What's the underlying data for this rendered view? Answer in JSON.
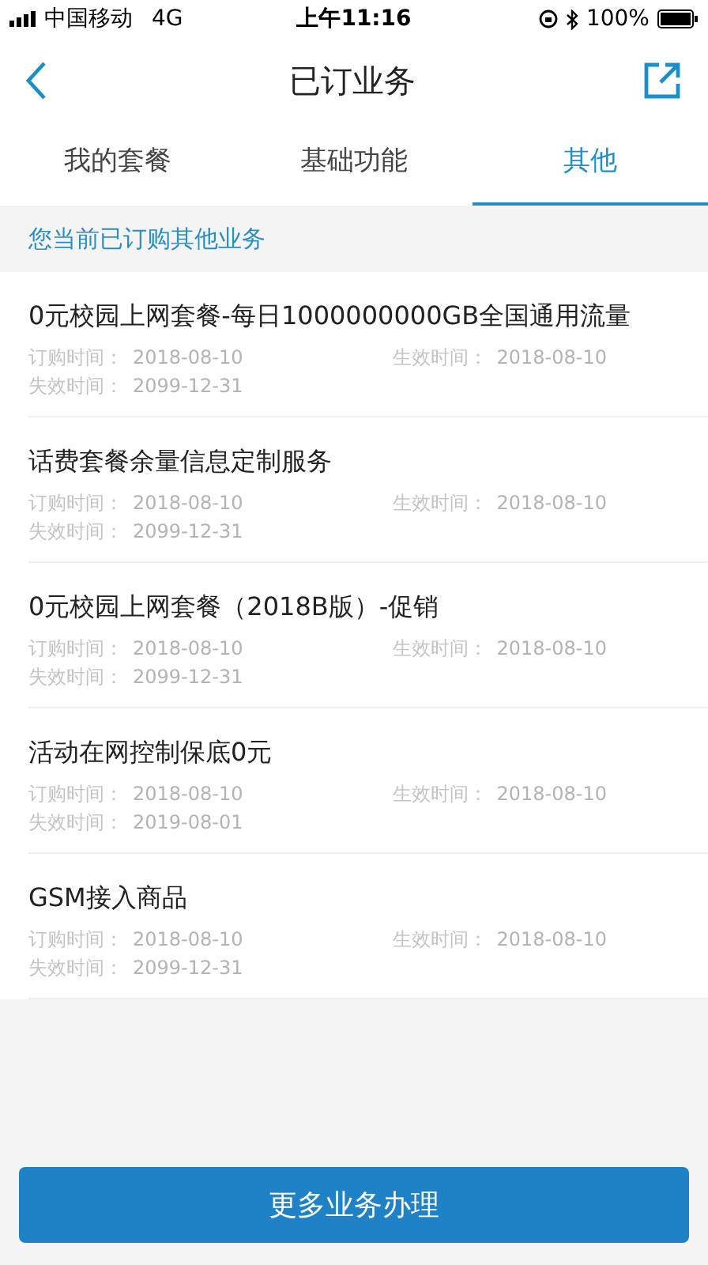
{
  "status_bar": {
    "carrier": "中国移动",
    "network": "4G",
    "time": "上午11:16",
    "battery": "100%"
  },
  "nav": {
    "title": "已订业务"
  },
  "tabs": [
    {
      "label": "我的套餐",
      "selected": false
    },
    {
      "label": "基础功能",
      "selected": false
    },
    {
      "label": "其他",
      "selected": true
    }
  ],
  "section_header": "您当前已订购其他业务",
  "services": [
    {
      "name": "0元校园上网套餐-每日1000000000GB全国通用流量",
      "ordered": {
        "label": "订购时间：",
        "value": "2018-08-10"
      },
      "effective": {
        "label": "生效时间：",
        "value": "2018-08-10"
      },
      "expires": {
        "label": "失效时间：",
        "value": "2099-12-31"
      }
    },
    {
      "name": "话费套餐余量信息定制服务",
      "ordered": {
        "label": "订购时间：",
        "value": "2018-08-10"
      },
      "effective": {
        "label": "生效时间：",
        "value": "2018-08-10"
      },
      "expires": {
        "label": "失效时间：",
        "value": "2099-12-31"
      }
    },
    {
      "name": "0元校园上网套餐（2018B版）-促销",
      "ordered": {
        "label": "订购时间：",
        "value": "2018-08-10"
      },
      "effective": {
        "label": "生效时间：",
        "value": "2018-08-10"
      },
      "expires": {
        "label": "失效时间：",
        "value": "2099-12-31"
      }
    },
    {
      "name": "活动在网控制保底0元",
      "ordered": {
        "label": "订购时间：",
        "value": "2018-08-10"
      },
      "effective": {
        "label": "生效时间：",
        "value": "2018-08-10"
      },
      "expires": {
        "label": "失效时间：",
        "value": "2019-08-01"
      }
    },
    {
      "name": "GSM接入商品",
      "ordered": {
        "label": "订购时间：",
        "value": "2018-08-10"
      },
      "effective": {
        "label": "生效时间：",
        "value": "2018-08-10"
      },
      "expires": {
        "label": "失效时间：",
        "value": "2099-12-31"
      }
    }
  ],
  "button": "更多业务办理"
}
